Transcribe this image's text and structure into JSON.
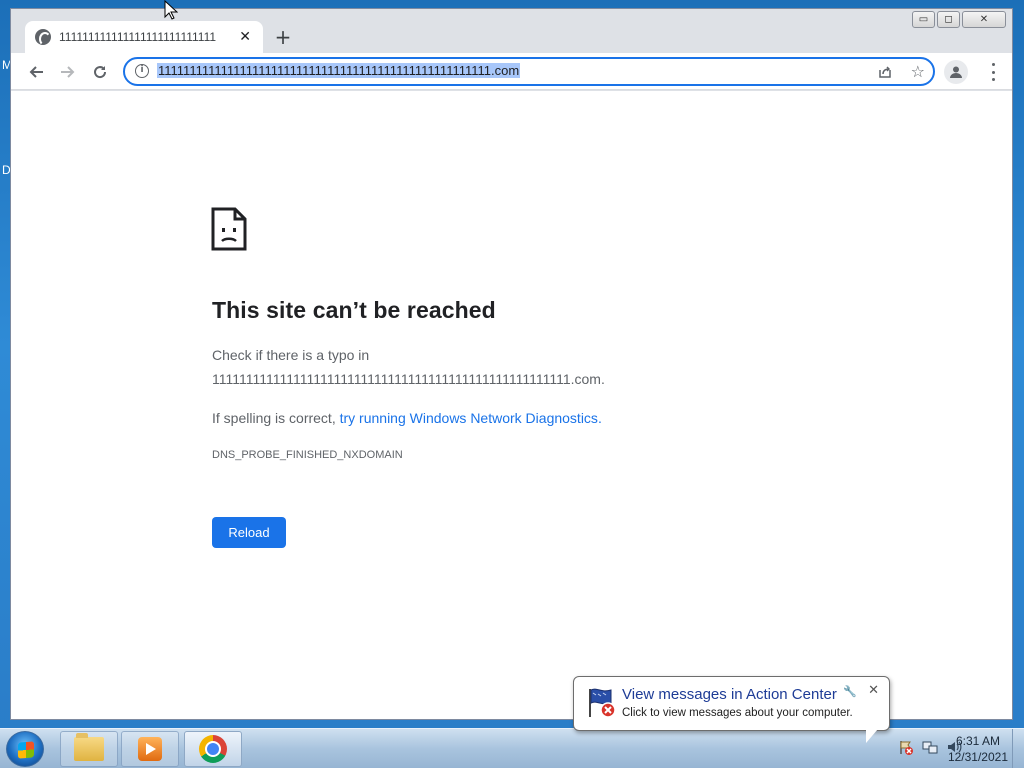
{
  "desktop": {
    "left_letters": [
      "M",
      "D"
    ]
  },
  "browser": {
    "tab": {
      "title": "111111111111111111111111111",
      "favicon": "globe-icon",
      "close": "✕"
    },
    "new_tab": "+",
    "window_controls": {
      "minimize": "▭",
      "maximize": "◻",
      "close": "✕"
    },
    "address": {
      "url": "11111111111111111111111111111111111111111111111111111.com"
    }
  },
  "error_page": {
    "title": "This site can’t be reached",
    "line1": "Check if there is a typo in",
    "line2": "11111111111111111111111111111111111111111111111111111.com.",
    "spelling_prefix": "If spelling is correct, ",
    "spelling_link": "try running Windows Network Diagnostics",
    "spelling_suffix": ".",
    "error_code": "DNS_PROBE_FINISHED_NXDOMAIN",
    "reload_label": "Reload"
  },
  "notification": {
    "title": "View messages in Action Center",
    "text": "Click to view messages about your computer."
  },
  "taskbar": {
    "clock_time": "6:31 AM",
    "clock_date": "12/31/2021"
  },
  "colors": {
    "accent": "#1a73e8",
    "selection": "#a8c7fa",
    "taskbar": "#a9c4de"
  }
}
